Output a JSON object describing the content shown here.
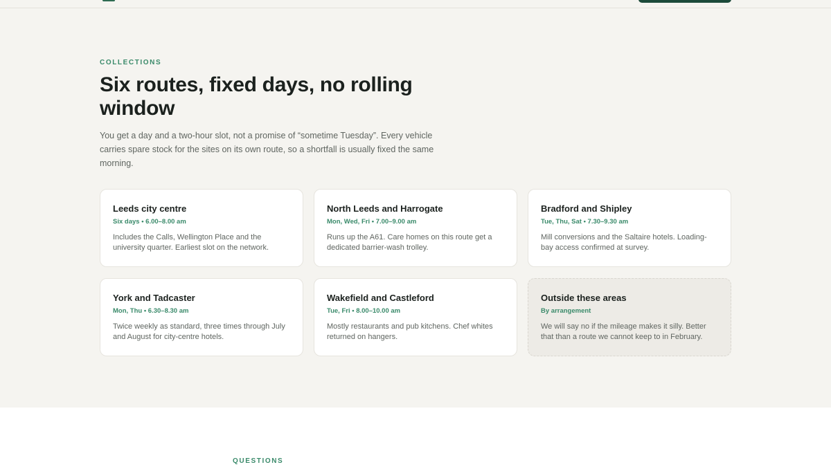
{
  "section": {
    "eyebrow": "COLLECTIONS",
    "heading": "Six routes, fixed days, no rolling window",
    "intro": "You get a day and a two-hour slot, not a promise of “sometime Tuesday”. Every vehicle carries spare stock for the sites on its own route, so a shortfall is usually fixed the same morning."
  },
  "routes": [
    {
      "title": "Leeds city centre",
      "schedule": "Six days • 6.00–8.00 am",
      "description": "Includes the Calls, Wellington Place and the university quarter. Earliest slot on the network."
    },
    {
      "title": "North Leeds and Harrogate",
      "schedule": "Mon, Wed, Fri • 7.00–9.00 am",
      "description": "Runs up the A61. Care homes on this route get a dedicated barrier-wash trolley."
    },
    {
      "title": "Bradford and Shipley",
      "schedule": "Tue, Thu, Sat • 7.30–9.30 am",
      "description": "Mill conversions and the Saltaire hotels. Loading-bay access confirmed at survey."
    },
    {
      "title": "York and Tadcaster",
      "schedule": "Mon, Thu • 6.30–8.30 am",
      "description": "Twice weekly as standard, three times through July and August for city-centre hotels."
    },
    {
      "title": "Wakefield and Castleford",
      "schedule": "Tue, Fri • 8.00–10.00 am",
      "description": "Mostly restaurants and pub kitchens. Chef whites returned on hangers."
    },
    {
      "title": "Outside these areas",
      "schedule": "By arrangement",
      "description": "We will say no if the mileage makes it silly. Better that than a route we cannot keep to in February."
    }
  ],
  "next_section": {
    "eyebrow": "QUESTIONS"
  }
}
